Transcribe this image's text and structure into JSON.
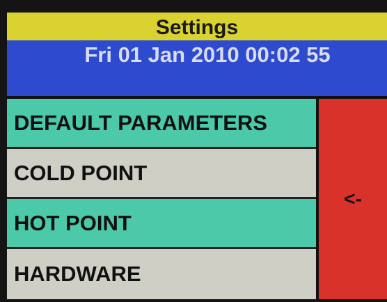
{
  "header": {
    "title": "Settings",
    "datetime": "Fri 01 Jan 2010 00:02 55"
  },
  "menu": {
    "items": [
      {
        "label": "DEFAULT PARAMETERS",
        "color": "#4cc9a8"
      },
      {
        "label": "COLD POINT",
        "color": "#cfcfc6"
      },
      {
        "label": "HOT POINT",
        "color": "#4cc9a8"
      },
      {
        "label": "HARDWARE",
        "color": "#cfcfc6"
      }
    ]
  },
  "back_button": {
    "label": "<-",
    "color": "#d8322a"
  },
  "colors": {
    "title_bar": "#d9d230",
    "date_bar": "#2e4bd0"
  }
}
